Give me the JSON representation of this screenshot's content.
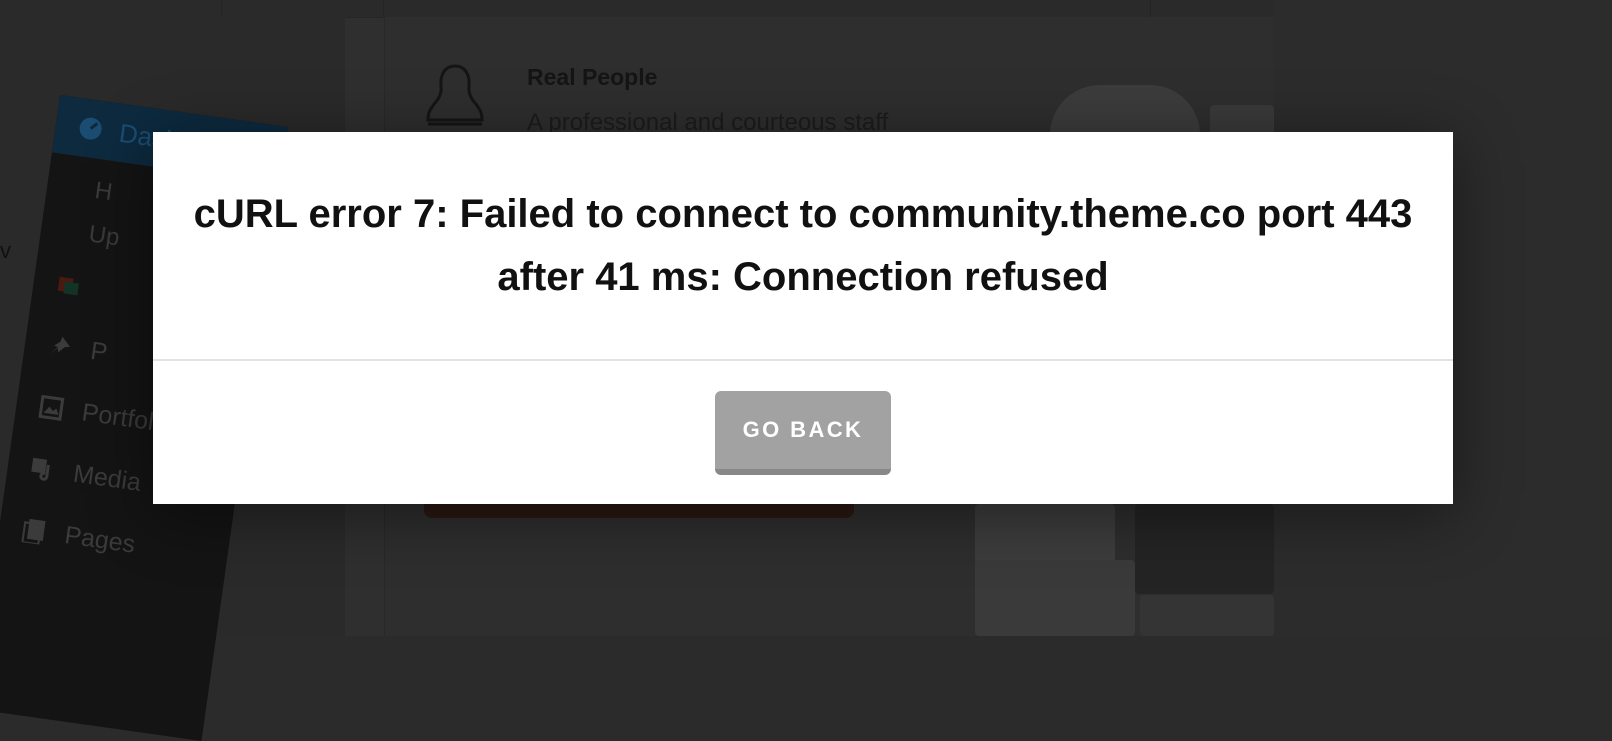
{
  "background": {
    "sidebar": {
      "active_item_label": "Dashb",
      "sub_items": [
        "H",
        "Up"
      ],
      "items": [
        {
          "label": "",
          "icon": "layers-icon"
        },
        {
          "label": "P",
          "icon": "pin-icon"
        },
        {
          "label": "Portfolio",
          "icon": "gallery-icon"
        },
        {
          "label": "Media",
          "icon": "media-icon"
        },
        {
          "label": "Pages",
          "icon": "pages-icon"
        }
      ]
    },
    "stray_text": "v",
    "feature": {
      "title": "Real People",
      "description": "A professional and courteous staff"
    }
  },
  "modal": {
    "message": "cURL error 7: Failed to connect to community.theme.co port 443 after 41 ms: Connection refused",
    "button_label": "GO BACK"
  },
  "colors": {
    "overlay": "#2b2b2b",
    "modal_bg": "#ffffff",
    "button_bg": "#a2a2a2",
    "button_text": "#ffffff",
    "message_text": "#111111"
  }
}
